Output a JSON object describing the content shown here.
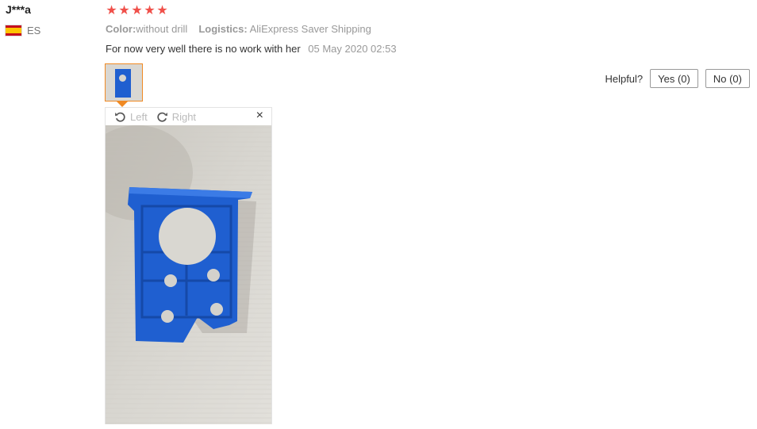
{
  "review": {
    "user_name": "J***a",
    "country_code": "ES",
    "rating": 5,
    "color_key": "Color:",
    "color_value": "without drill",
    "logistics_key": "Logistics:",
    "logistics_value": "AliExpress Saver Shipping",
    "text": "For now very well there is no work with her",
    "date": "05 May 2020 02:53"
  },
  "helpful": {
    "label": "Helpful?",
    "yes": "Yes (0)",
    "no": "No (0)"
  },
  "viewer": {
    "left": "Left",
    "right": "Right",
    "close": "×"
  },
  "colors": {
    "star": "#f0504a",
    "thumb_border": "#f08a24",
    "muted_text": "#999999",
    "product_blue": "#1f5fd0"
  },
  "icons": [
    "spain-flag-icon",
    "star-icon",
    "rotate-left-icon",
    "rotate-right-icon",
    "close-icon"
  ]
}
